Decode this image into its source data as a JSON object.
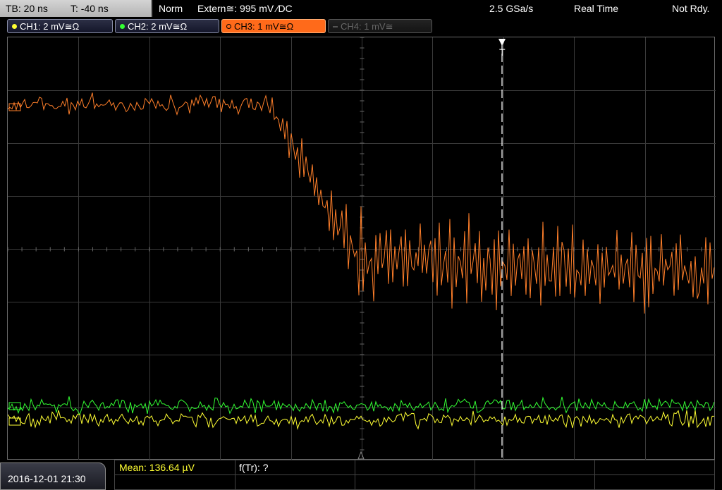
{
  "timebase": {
    "tb": "TB: 20 ns",
    "trigger_time": "T: -40 ns"
  },
  "status": {
    "mode": "Norm",
    "source": "Extern≅: 995 mV ∕DC",
    "sample_rate": "2.5 GSa/s",
    "acq_mode": "Real Time",
    "state": "Not Rdy."
  },
  "channels": [
    {
      "label": "CH1: 2 mV≅Ω",
      "color": "#ffff33",
      "state": "on"
    },
    {
      "label": "CH2: 2 mV≅Ω",
      "color": "#33ff33",
      "state": "on"
    },
    {
      "label": "CH3: 1 mV≅Ω",
      "color": "#ff7f2a",
      "state": "active"
    },
    {
      "label": "CH4: 1 mV≅",
      "color": "#888888",
      "state": "off"
    }
  ],
  "trigger_marker": "T",
  "datetime": "2016-12-01 21:30",
  "measurements": {
    "mean": "Mean: 136.64 µV",
    "ftr": "f(Tr): ?"
  },
  "colors": {
    "ch1": "#ffff33",
    "ch2": "#33ff33",
    "ch3": "#ff7f2a",
    "grid": "#3a3a3a"
  }
}
